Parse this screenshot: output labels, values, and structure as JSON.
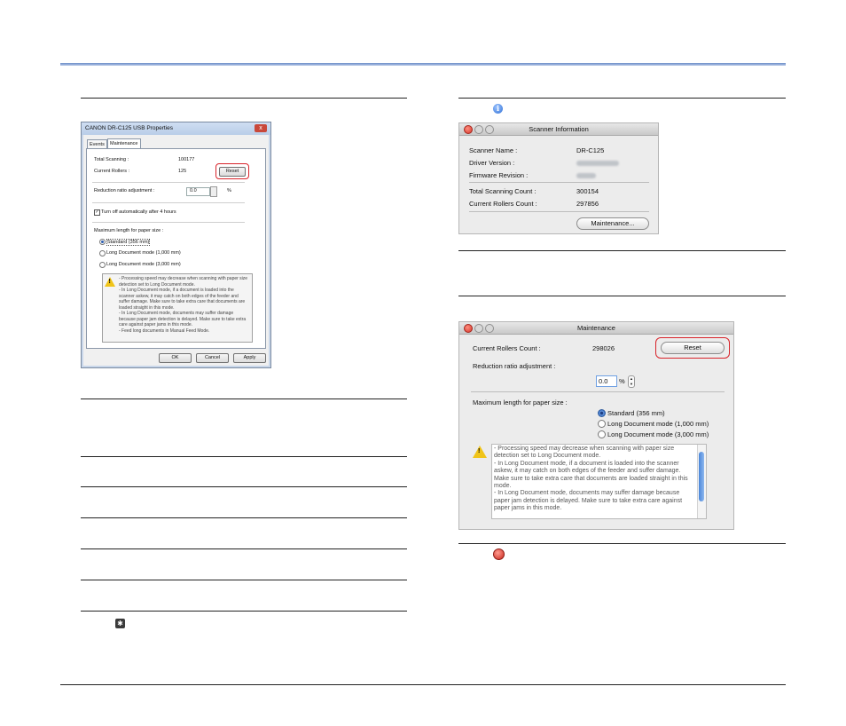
{
  "win_dialog": {
    "title": "CANON DR-C125 USB Properties",
    "close_glyph": "x",
    "tabs": [
      "Events",
      "Maintenance"
    ],
    "total_scanning_label": "Total Scanning :",
    "total_scanning_value": "100177",
    "current_rollers_label": "Current Rollers :",
    "current_rollers_value": "125",
    "reset_label": "Reset",
    "reduction_label": "Reduction ratio adjustment :",
    "reduction_value": "0.0",
    "reduction_unit": "%",
    "turn_off_label": "Turn off automatically after 4 hours",
    "max_length_label": "Maximum length for paper size :",
    "radio_options": [
      "Standard (356 mm)",
      "Long Document mode (1,000 mm)",
      "Long Document mode (3,000 mm)"
    ],
    "warning_text": "- Processing speed may decrease when scanning with paper size detection set to Long Document mode.\n- In Long Document mode, if a document is loaded into the scanner askew, it may catch on both edges of the feeder and suffer damage. Make sure to take extra care that documents are loaded straight in this mode.\n- In Long Document mode, documents may suffer damage because paper jam detection is delayed. Make sure to take extra care against paper jams in this mode.\n- Feed long documents in Manual Feed Mode.",
    "ok_label": "OK",
    "cancel_label": "Cancel",
    "apply_label": "Apply"
  },
  "scanner_info": {
    "title": "Scanner Information",
    "scanner_name_label": "Scanner Name :",
    "scanner_name_value": "DR-C125",
    "driver_version_label": "Driver Version :",
    "firmware_label": "Firmware Revision :",
    "total_count_label": "Total Scanning Count :",
    "total_count_value": "300154",
    "rollers_count_label": "Current Rollers Count :",
    "rollers_count_value": "297856",
    "maintenance_label": "Maintenance..."
  },
  "mac_maintenance": {
    "title": "Maintenance",
    "rollers_label": "Current Rollers Count :",
    "rollers_value": "298026",
    "reset_label": "Reset",
    "reduction_label": "Reduction ratio adjustment :",
    "reduction_value": "0.0",
    "reduction_unit": "%",
    "max_length_label": "Maximum length for paper size :",
    "radio_options": [
      "Standard (356 mm)",
      "Long Document mode (1,000 mm)",
      "Long Document mode (3,000 mm)"
    ],
    "warning_text": "- Processing speed may decrease when scanning with paper size detection set to Long Document mode.\n- In Long Document mode, if a document is loaded into the scanner askew, it may catch on both edges of the feeder and suffer damage. Make sure to take extra care that documents are loaded straight in this mode.\n- In Long Document mode, documents may suffer damage because paper jam detection is delayed. Make sure to take extra care against paper jams in this mode."
  },
  "icons": {
    "info": "info-icon",
    "close": "red-close-icon",
    "gear": "gear-icon"
  },
  "colors": {
    "header_bar": "#6d8fc9",
    "highlight": "#d8232a"
  }
}
